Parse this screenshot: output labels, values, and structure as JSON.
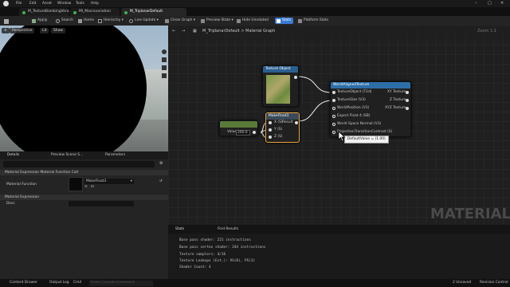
{
  "menu": [
    "File",
    "Edit",
    "Asset",
    "Window",
    "Tools",
    "Help"
  ],
  "tabs": [
    {
      "label": "M_TextureBombingVera...",
      "active": false
    },
    {
      "label": "MI_Macrovariation",
      "active": false
    },
    {
      "label": "M_TriplanarDefault",
      "active": true
    }
  ],
  "toolbar": [
    "Apply",
    "Search",
    "Home",
    "Hierarchy",
    "Live Update",
    "Clean Graph",
    "Preview State",
    "Hide Unrelated",
    "Stats",
    "Platform Stats"
  ],
  "viewport": {
    "perspective": "Perspective",
    "lit": "Lit",
    "show": "Show"
  },
  "details": {
    "tabs": [
      "Details",
      "Preview Scene S...",
      "Parameters"
    ],
    "section1": "Material Expression Material Function Call",
    "function_label": "Material Function",
    "function_value": "MakeFloat3",
    "section2": "Material Expression",
    "desc_label": "Desc"
  },
  "graph": {
    "breadcrumb": "M_TriplanarDefault > Material Graph",
    "zoom": "Zoom 1:1",
    "watermark": "MATERIAL",
    "texture_object": {
      "title": "Texture Object"
    },
    "param": {
      "label": "Value",
      "value": "200.0"
    },
    "makefloat3": {
      "title": "MakeFloat3",
      "inputs": [
        "X (S)",
        "Y (S)",
        "Z (S)"
      ],
      "output": "Result"
    },
    "wat": {
      "title": "WorldAlignedTexture",
      "inputs": [
        "TextureObject (T2d)",
        "TextureSize (V3)",
        "WorldPosition (V3)",
        "Export Float 4 (SB)",
        "World Space Normal (V3)",
        "ProjectionTransitionContrast (S)"
      ],
      "outputs": [
        "XY Texture",
        "Z Texture",
        "XYZ Texture"
      ]
    },
    "tooltip": "DefaultValue = (1.00)"
  },
  "stats": {
    "tabs": [
      "Stats",
      "Find Results"
    ],
    "lines": [
      "Base pass shader: 221 instructions",
      "Base pass vertex shader: 244 instructions",
      "Texture samplers: 4/16",
      "Texture Lookups (Est.): VS(0), PS(3)",
      "Shader Count: 4"
    ]
  },
  "status": {
    "content_drawer": "Content Drawer",
    "output_log": "Output Log",
    "cmd": "Cmd",
    "cmd_placeholder": "Enter Console Command",
    "unsaved": "2 Unsaved",
    "revision": "Revision Control"
  },
  "colors": {
    "accent": "#3a7bd5",
    "wat_header": "#2d6ea8",
    "tex_header": "#2b5f8f",
    "mf3_header": "#3a4a5a",
    "param_header": "#5a7a3a",
    "selected": "#e8a23a"
  }
}
